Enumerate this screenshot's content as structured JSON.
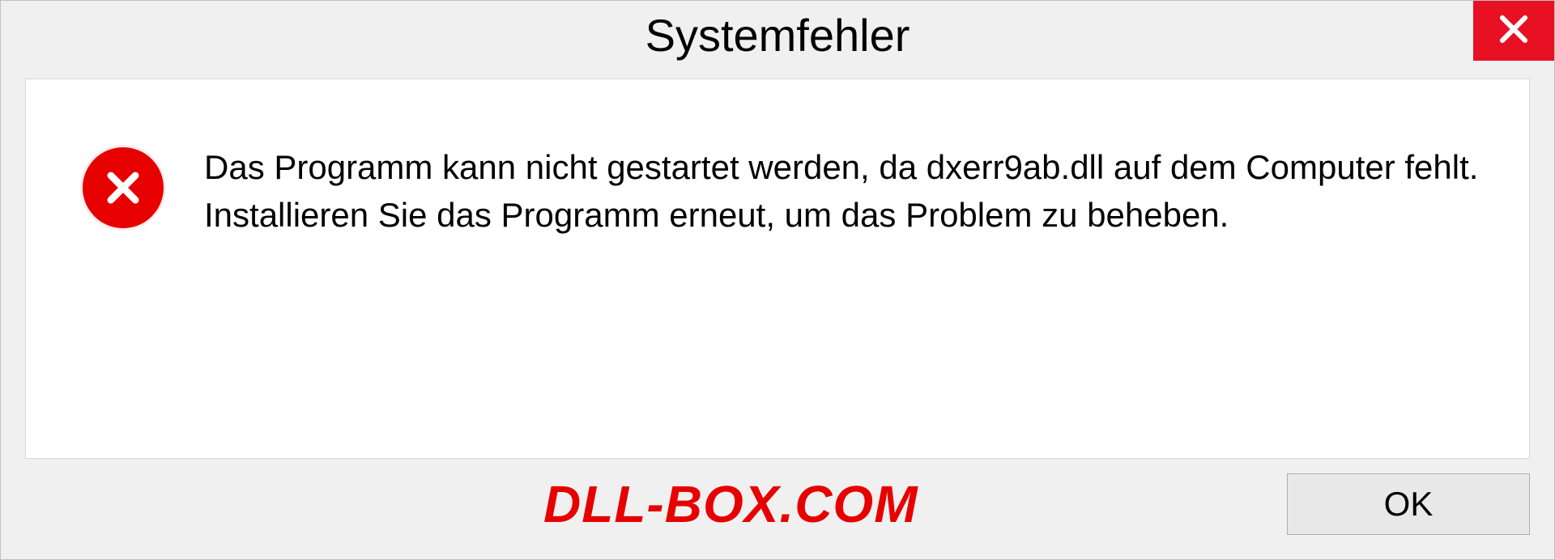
{
  "titlebar": {
    "title": "Systemfehler"
  },
  "message": {
    "text": "Das Programm kann nicht gestartet werden, da dxerr9ab.dll auf dem Computer fehlt. Installieren Sie das Programm erneut, um das Problem zu beheben."
  },
  "footer": {
    "watermark": "DLL-BOX.COM",
    "ok_label": "OK"
  },
  "colors": {
    "close_red": "#e81123",
    "error_red": "#e60000",
    "watermark_red": "#e60000"
  }
}
